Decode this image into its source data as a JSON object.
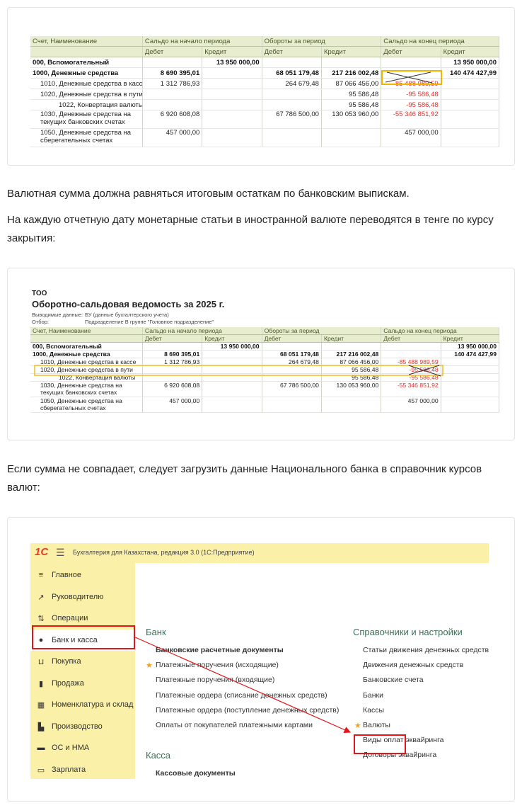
{
  "table_headers": {
    "account": "Счет, Наименование",
    "open": "Сальдо на начало периода",
    "turnover": "Обороты за период",
    "close": "Сальдо на конец периода",
    "debit": "Дебет",
    "credit": "Кредит"
  },
  "card1": {
    "rows": [
      {
        "name": "000, Вспомогательный",
        "od": "",
        "oc": "13 950 000,00",
        "td": "",
        "tc": "",
        "cd": "",
        "cc": "13 950 000,00",
        "bold": true
      },
      {
        "name": "1000, Денежные средства",
        "od": "8 690 395,01",
        "oc": "",
        "td": "68 051 179,48",
        "tc": "217 216 002,48",
        "cd": "",
        "cc": "140 474 427,99",
        "bold": true
      },
      {
        "name": "1010, Денежные средства в кассе",
        "od": "1 312 786,93",
        "oc": "",
        "td": "264 679,48",
        "tc": "87 066 456,00",
        "cd": "-85 488 989,59",
        "cc": ""
      },
      {
        "name": "1020, Денежные средства в пути",
        "od": "",
        "oc": "",
        "td": "",
        "tc": "95 586,48",
        "cd": "-95 586,48",
        "cc": ""
      },
      {
        "name": "1022, Конвертация валюты",
        "od": "",
        "oc": "",
        "td": "",
        "tc": "95 586,48",
        "cd": "-95 586,48",
        "cc": ""
      },
      {
        "name": "1030, Денежные средства на текущих банковских счетах",
        "od": "6 920 608,08",
        "oc": "",
        "td": "67 786 500,00",
        "tc": "130 053 960,00",
        "cd": "-55 346 851,92",
        "cc": ""
      },
      {
        "name": "1050, Денежные средства на сберегательных счетах",
        "od": "457 000,00",
        "oc": "",
        "td": "",
        "tc": "",
        "cd": "457 000,00",
        "cc": ""
      }
    ]
  },
  "para1": "Валютная сумма должна равняться итоговым остаткам по банковским выпискам.",
  "para2": "На каждую отчетную дату монетарные статьи в иностранной валюте переводятся в тенге по курсу закрытия:",
  "card2": {
    "org": "ТОО",
    "title": "Оборотно-сальдовая ведомость  за 2025 г.",
    "meta1_label": "Выводимые данные:",
    "meta1_value": "БУ (данные бухгалтерского учета)",
    "meta2_label": "Отбор:",
    "meta2_value": "Подразделение В группе \"Головное подразделение\""
  },
  "para3": "Если сумма не совпадает, следует загрузить данные Национального банка в справочник курсов валют:",
  "app": {
    "title": "Бухгалтерия для Казахстана, редакция 3.0  (1С:Предприятие)",
    "logo": "1С",
    "sidebar": [
      {
        "label": "Главное",
        "icon": "≡"
      },
      {
        "label": "Руководителю",
        "icon": "↗"
      },
      {
        "label": "Операции",
        "icon": "⇅"
      },
      {
        "label": "Банк и касса",
        "icon": "●"
      },
      {
        "label": "Покупка",
        "icon": "⊔"
      },
      {
        "label": "Продажа",
        "icon": "▮"
      },
      {
        "label": "Номенклатура и склад",
        "icon": "▦"
      },
      {
        "label": "Производство",
        "icon": "▙"
      },
      {
        "label": "ОС и НМА",
        "icon": "▬"
      },
      {
        "label": "Зарплата",
        "icon": "▭"
      }
    ],
    "bank_title": "Банк",
    "bank_links": [
      "Банковские расчетные документы",
      "Платежные поручения (исходящие)",
      "Платежные поручения (входящие)",
      "Платежные ордера (списание денежных средств)",
      "Платежные ордера (поступление денежных средств)",
      "Оплаты от покупателей платежными картами"
    ],
    "kassa_title": "Касса",
    "kassa_links": [
      "Кассовые документы"
    ],
    "ref_title": "Справочники и настройки",
    "ref_links": [
      "Статьи движения денежных средств",
      "Движения денежных средств",
      "Банковские счета",
      "Банки",
      "Кассы",
      "Валюты",
      "Виды оплат эквайринга",
      "Договоры эквайринга"
    ]
  }
}
